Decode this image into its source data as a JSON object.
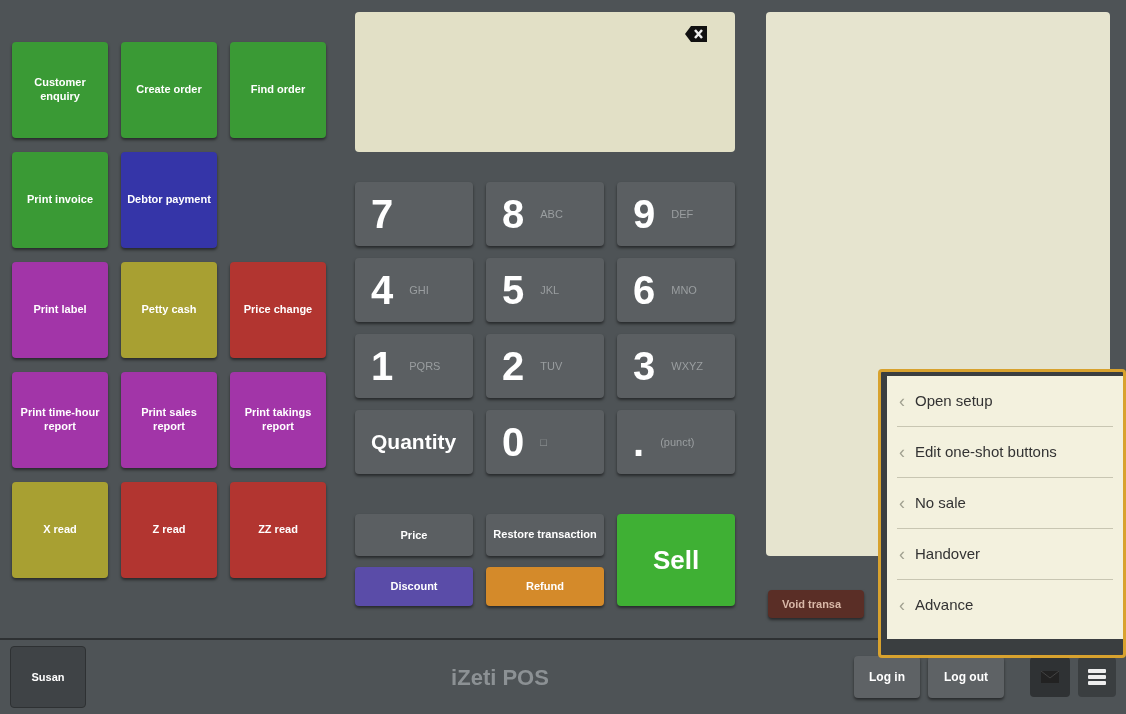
{
  "function_buttons": [
    {
      "label": "Customer enquiry",
      "color": "#3a9a35"
    },
    {
      "label": "Create order",
      "color": "#3a9a35"
    },
    {
      "label": "Find order",
      "color": "#3a9a35"
    },
    {
      "label": "Print invoice",
      "color": "#3a9a35"
    },
    {
      "label": "Debtor payment",
      "color": "#3535a8"
    },
    {
      "kind": "empty"
    },
    {
      "label": "Print label",
      "color": "#a235a8"
    },
    {
      "label": "Petty cash",
      "color": "#a8a032"
    },
    {
      "label": "Price change",
      "color": "#b23530"
    },
    {
      "label": "Print time-hour report",
      "color": "#a235a8"
    },
    {
      "label": "Print sales report",
      "color": "#a235a8"
    },
    {
      "label": "Print takings report",
      "color": "#a235a8"
    },
    {
      "label": "X read",
      "color": "#a8a032"
    },
    {
      "label": "Z read",
      "color": "#b23530"
    },
    {
      "label": "ZZ read",
      "color": "#b23530"
    }
  ],
  "keypad": [
    {
      "main": "7"
    },
    {
      "main": "8",
      "sub": "ABC"
    },
    {
      "main": "9",
      "sub": "DEF"
    },
    {
      "main": "4",
      "sub": "GHI"
    },
    {
      "main": "5",
      "sub": "JKL"
    },
    {
      "main": "6",
      "sub": "MNO"
    },
    {
      "main": "1",
      "sub": "PQRS"
    },
    {
      "main": "2",
      "sub": "TUV"
    },
    {
      "main": "3",
      "sub": "WXYZ"
    },
    {
      "main": "Quantity",
      "kind": "word"
    },
    {
      "main": "0",
      "sub": "□"
    },
    {
      "main": ".",
      "sub": "(punct)"
    }
  ],
  "actions": {
    "price": "Price",
    "restore": "Restore transaction",
    "discount": "Discount",
    "refund": "Refund",
    "sell": "Sell"
  },
  "void_button": "Void transa",
  "user_button": "Susan",
  "brand": "iZeti POS",
  "login": "Log in",
  "logout": "Log out",
  "menu": {
    "open": true,
    "items": [
      {
        "label": "Open setup",
        "arrow": "‹"
      },
      {
        "label": "Edit one-shot buttons",
        "arrow": "‹"
      },
      {
        "label": "No sale",
        "arrow": "‹"
      },
      {
        "label": "Handover",
        "arrow": "‹"
      },
      {
        "label": "Advance",
        "arrow": "‹"
      }
    ]
  }
}
